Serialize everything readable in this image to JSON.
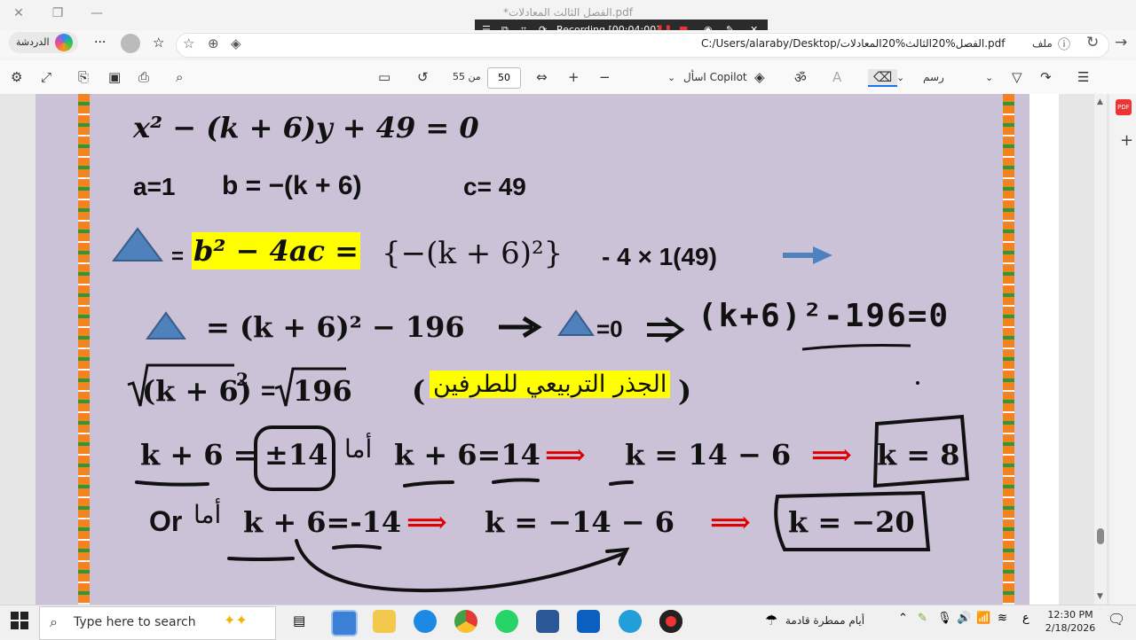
{
  "window": {
    "title": "*الفصل الثالث المعادلات.pdf"
  },
  "recording": {
    "label": "Recording [00:04:00]"
  },
  "browser": {
    "chat_label": "الدردشة",
    "url": "C:/Users/alaraby/Desktop/الفصل%20الثالث%20المعادلات.pdf",
    "file_label": "ملف"
  },
  "pdf_toolbar": {
    "page_current": "50",
    "page_of": "من 55",
    "ask_copilot": "اسأل Copilot",
    "draw": "رسم"
  },
  "page": {
    "eq1": "x² − (k + 6)y + 49 = 0",
    "a": "a=1",
    "b": "b = −(k + 6)",
    "c": "c= 49",
    "eq_equals": "=",
    "disc_formula": "b² − 4ac =",
    "disc_expand": "{−(k + 6)²}",
    "disc_tail": "- 4 × 1(49)",
    "line4a": "= (k + 6)² − 196",
    "line4b": "=0",
    "handwritten1": "(k+6)²-196=0",
    "sqrt_left": "(k + 6)",
    "sqrt_exp": "2",
    "sqrt_eq": "=",
    "sqrt_right": "196",
    "arabic_note": "الجذر التربيعي للطرفين",
    "open_paren": "(",
    "close_paren": ")",
    "l6_left": "k + 6 =",
    "l6_pm": "±14",
    "l6_ama": "أما",
    "l6_mid": "k + 6=14",
    "l6_arrow": "⟹",
    "l6_res": "k = 14 − 6",
    "l6_final": "k = 8",
    "l7_or": "Or",
    "l7_ama": "أما",
    "l7_mid": "k + 6=-14",
    "l7_res": "k = −14 − 6",
    "l7_final": "k = −20"
  },
  "taskbar": {
    "search_placeholder": "Type here to search",
    "weather": "أيام ممطرة قادمة",
    "time": "12:30 PM",
    "date": "2/18/2026"
  },
  "colors": {
    "page_bg": "#cbc2d8",
    "highlight": "#ffff00",
    "triangle": "#4f81bd",
    "arrow_red": "#e00000"
  }
}
